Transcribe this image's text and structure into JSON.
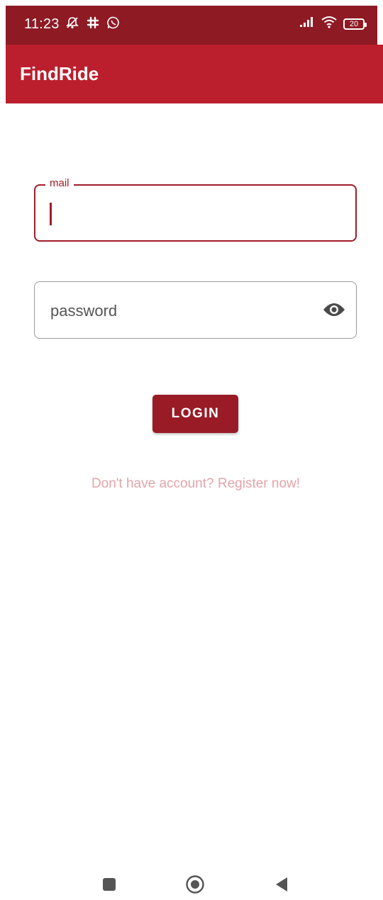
{
  "status_bar": {
    "time": "11:23",
    "battery_level": "20",
    "icons_left": [
      "mute-icon",
      "slack-icon",
      "whatsapp-icon"
    ],
    "icons_right": [
      "signal-icon",
      "wifi-icon",
      "battery-icon"
    ]
  },
  "app_bar": {
    "title": "FindRide"
  },
  "login_form": {
    "mail_label": "mail",
    "mail_value": "",
    "password_placeholder": "password",
    "password_value": "",
    "login_label": "LOGIN",
    "register_text": "Don't have account? Register now!"
  },
  "nav_bar": {
    "items": [
      "recent-apps",
      "home",
      "back"
    ]
  },
  "colors": {
    "status_bar": "#8e1a24",
    "app_bar": "#bb1f2d",
    "accent": "#a11c29",
    "button": "#981b26",
    "register_text": "#e3a3a9"
  }
}
